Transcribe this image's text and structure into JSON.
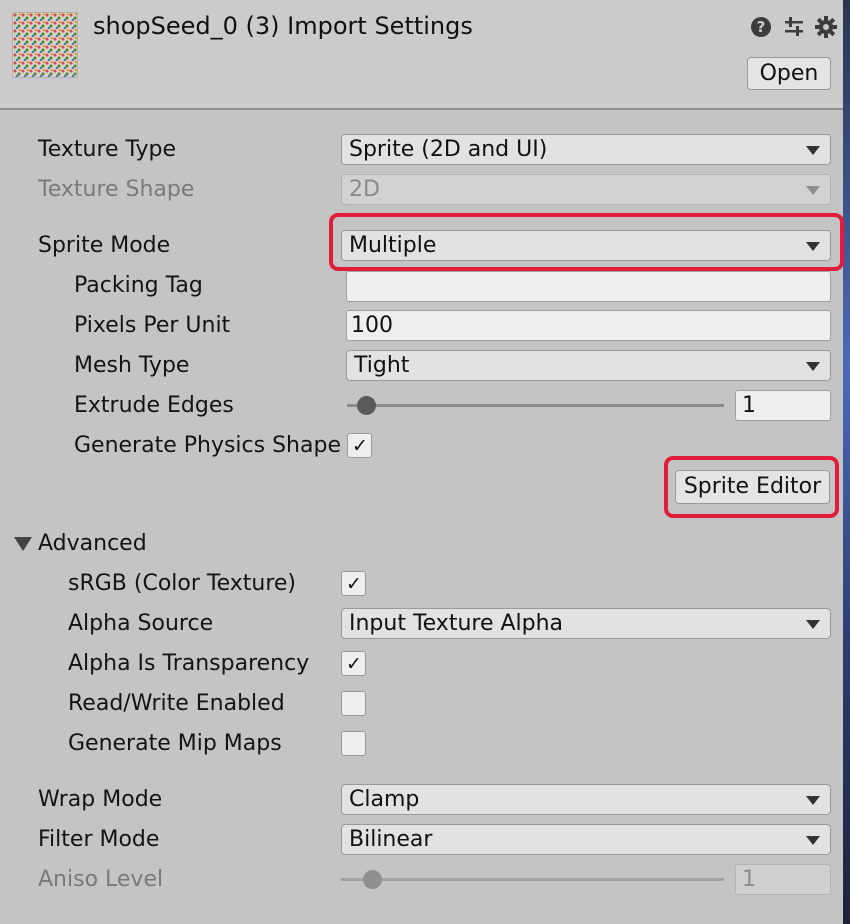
{
  "header": {
    "title": "shopSeed_0 (3) Import Settings",
    "open_label": "Open",
    "icons": [
      "help-icon",
      "presets-icon",
      "gear-icon"
    ]
  },
  "fields": {
    "texture_type": {
      "label": "Texture Type",
      "value": "Sprite (2D and UI)"
    },
    "texture_shape": {
      "label": "Texture Shape",
      "value": "2D"
    },
    "sprite_mode": {
      "label": "Sprite Mode",
      "value": "Multiple"
    },
    "packing_tag": {
      "label": "Packing Tag",
      "value": ""
    },
    "pixels_per_unit": {
      "label": "Pixels Per Unit",
      "value": "100"
    },
    "mesh_type": {
      "label": "Mesh Type",
      "value": "Tight"
    },
    "extrude_edges": {
      "label": "Extrude Edges",
      "value": "1"
    },
    "generate_physics_shape": {
      "label": "Generate Physics Shape",
      "checked": true
    },
    "sprite_editor_label": "Sprite Editor"
  },
  "advanced": {
    "label": "Advanced",
    "srgb": {
      "label": "sRGB (Color Texture)",
      "checked": true
    },
    "alpha_source": {
      "label": "Alpha Source",
      "value": "Input Texture Alpha"
    },
    "alpha_is_transparency": {
      "label": "Alpha Is Transparency",
      "checked": true
    },
    "read_write": {
      "label": "Read/Write Enabled",
      "checked": false
    },
    "mip_maps": {
      "label": "Generate Mip Maps",
      "checked": false
    }
  },
  "bottom": {
    "wrap_mode": {
      "label": "Wrap Mode",
      "value": "Clamp"
    },
    "filter_mode": {
      "label": "Filter Mode",
      "value": "Bilinear"
    },
    "aniso_level": {
      "label": "Aniso Level",
      "value": "1"
    }
  },
  "check_glyph": "✓",
  "colors": {
    "highlight": "#e01e3c"
  }
}
